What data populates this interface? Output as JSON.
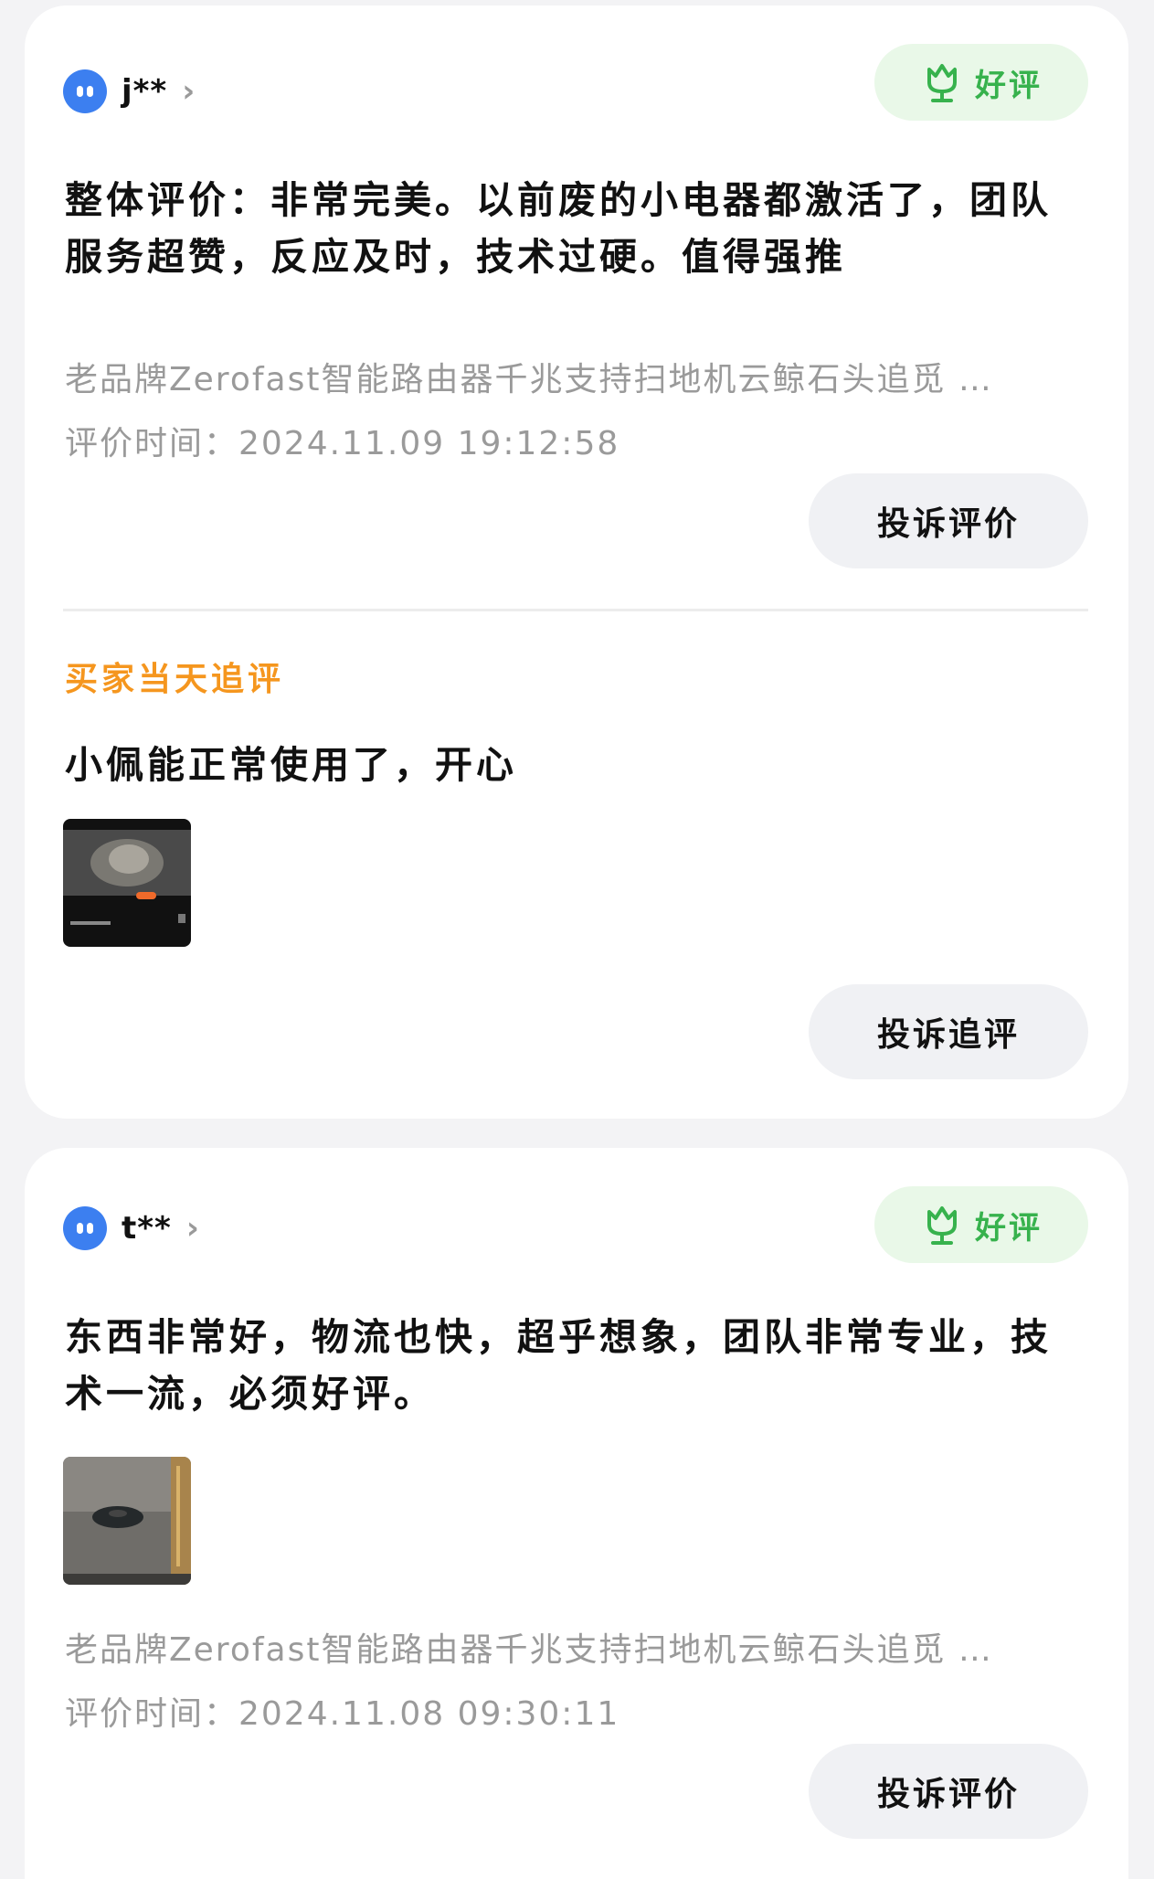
{
  "reviews": [
    {
      "username": "j**",
      "badge": "好评",
      "text": "整体评价：非常完美。以前废的小电器都激活了，团队服务超赞，反应及时，技术过硬。值得强推",
      "product": "老品牌Zerofast智能路由器千兆支持扫地机云鲸石头追觅 …",
      "time": "评价时间：2024.11.09 19:12:58",
      "complain_label": "投诉评价",
      "followup": {
        "label": "买家当天追评",
        "text": "小佩能正常使用了，开心",
        "complain_label": "投诉追评"
      }
    },
    {
      "username": "t**",
      "badge": "好评",
      "text": "东西非常好，物流也快，超乎想象，团队非常专业，技术一流，必须好评。",
      "product": "老品牌Zerofast智能路由器千兆支持扫地机云鲸石头追觅 …",
      "time": "评价时间：2024.11.08 09:30:11",
      "complain_label": "投诉评价"
    }
  ],
  "colors": {
    "good_badge_bg": "#e9f8e8",
    "good_badge_text": "#37b24d",
    "followup_label": "#f5961e",
    "avatar": "#3c7ff0"
  }
}
